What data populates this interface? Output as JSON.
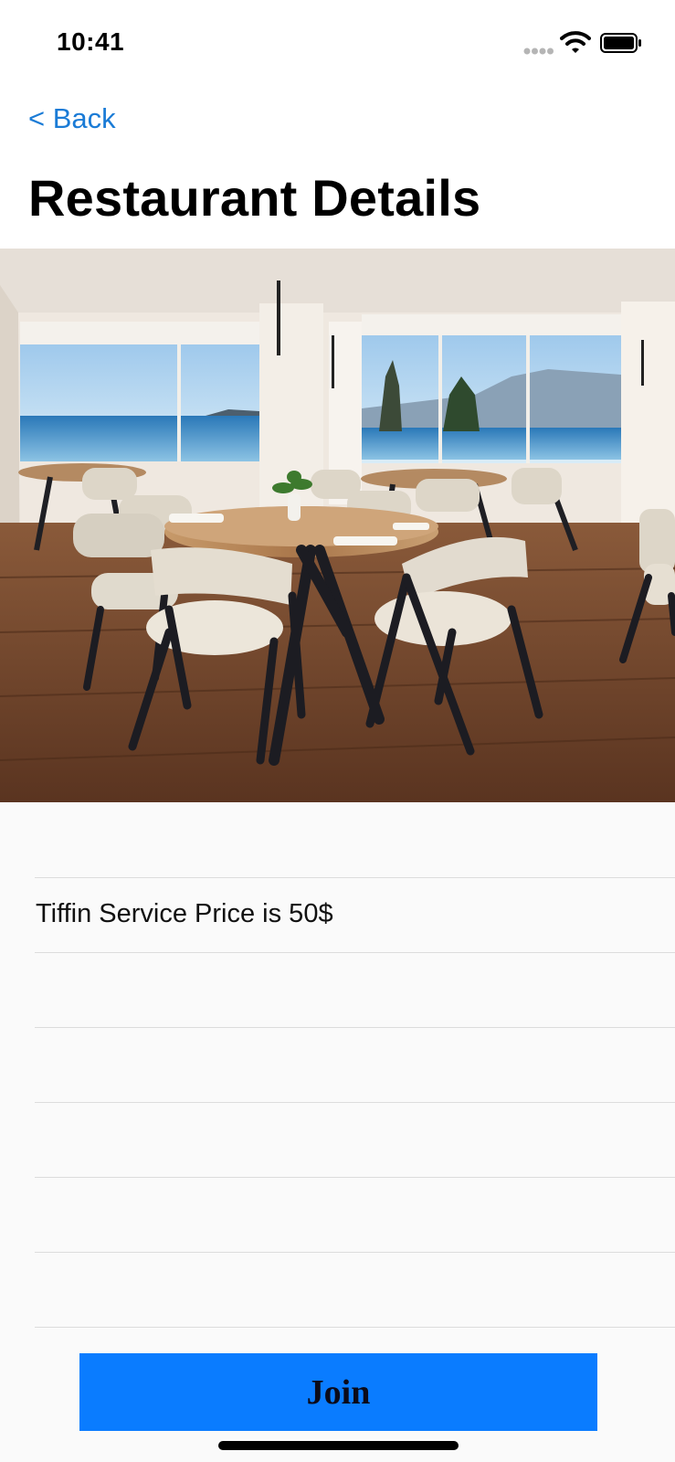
{
  "status_bar": {
    "time": "10:41",
    "icons": [
      "cellular-signal-icon",
      "wifi-icon",
      "battery-icon"
    ]
  },
  "nav": {
    "back_label": "< Back",
    "title": "Restaurant Details"
  },
  "image": {
    "subject": "restaurant-dining-room-photo"
  },
  "list": {
    "rows": [
      "",
      "Tiffin Service Price is 50$",
      "",
      "",
      "",
      "",
      ""
    ]
  },
  "join_button": {
    "label": "Join"
  },
  "colors": {
    "accent": "#1a7bd6",
    "button": "#0a7cff",
    "separator": "#dcdcdc"
  }
}
